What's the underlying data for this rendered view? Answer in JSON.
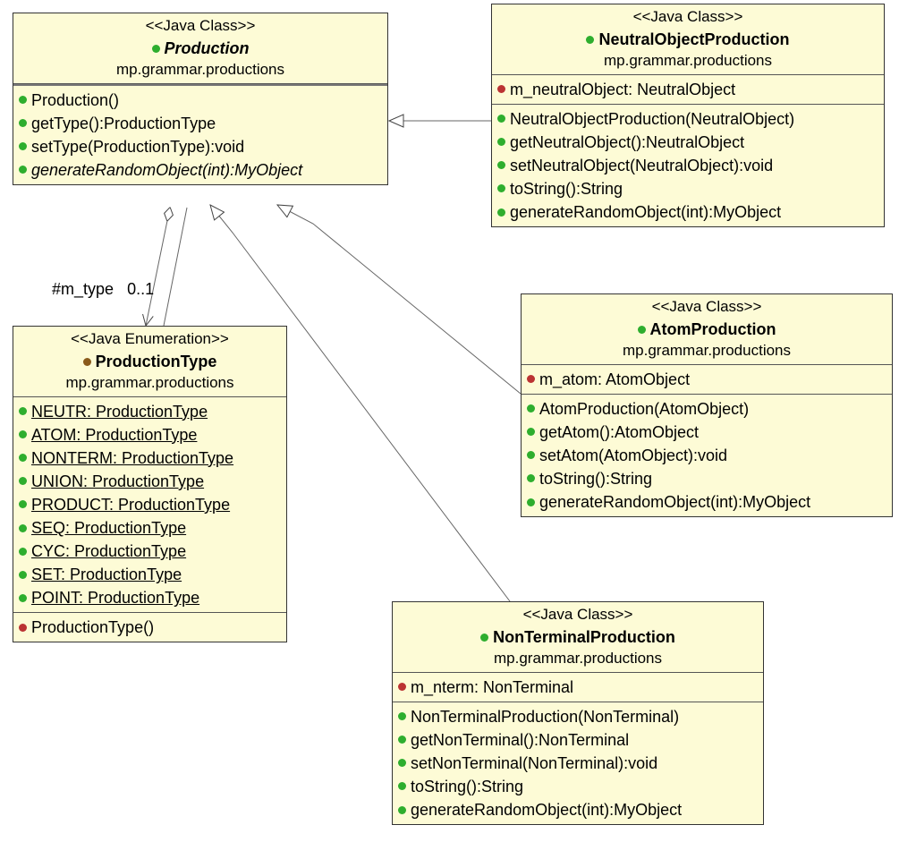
{
  "production": {
    "stereotype": "<<Java Class>>",
    "name": "Production",
    "pkg": "mp.grammar.productions",
    "members": [
      "Production()",
      "getType():ProductionType",
      "setType(ProductionType):void",
      "generateRandomObject(int):MyObject"
    ]
  },
  "productionType": {
    "stereotype": "<<Java Enumeration>>",
    "name": "ProductionType",
    "pkg": "mp.grammar.productions",
    "values": [
      "NEUTR: ProductionType",
      "ATOM: ProductionType",
      "NONTERM: ProductionType",
      "UNION: ProductionType",
      "PRODUCT: ProductionType",
      "SEQ: ProductionType",
      "CYC: ProductionType",
      "SET: ProductionType",
      "POINT: ProductionType"
    ],
    "ctor": "ProductionType()"
  },
  "neutral": {
    "stereotype": "<<Java Class>>",
    "name": "NeutralObjectProduction",
    "pkg": "mp.grammar.productions",
    "attr": "m_neutralObject: NeutralObject",
    "ops": [
      "NeutralObjectProduction(NeutralObject)",
      "getNeutralObject():NeutralObject",
      "setNeutralObject(NeutralObject):void",
      "toString():String",
      "generateRandomObject(int):MyObject"
    ]
  },
  "atom": {
    "stereotype": "<<Java Class>>",
    "name": "AtomProduction",
    "pkg": "mp.grammar.productions",
    "attr": "m_atom: AtomObject",
    "ops": [
      "AtomProduction(AtomObject)",
      "getAtom():AtomObject",
      "setAtom(AtomObject):void",
      "toString():String",
      "generateRandomObject(int):MyObject"
    ]
  },
  "nonterm": {
    "stereotype": "<<Java Class>>",
    "name": "NonTerminalProduction",
    "pkg": "mp.grammar.productions",
    "attr": "m_nterm: NonTerminal",
    "ops": [
      "NonTerminalProduction(NonTerminal)",
      "getNonTerminal():NonTerminal",
      "setNonTerminal(NonTerminal):void",
      "toString():String",
      "generateRandomObject(int):MyObject"
    ]
  },
  "assoc_label": "#m_type",
  "assoc_mult": "0..1"
}
